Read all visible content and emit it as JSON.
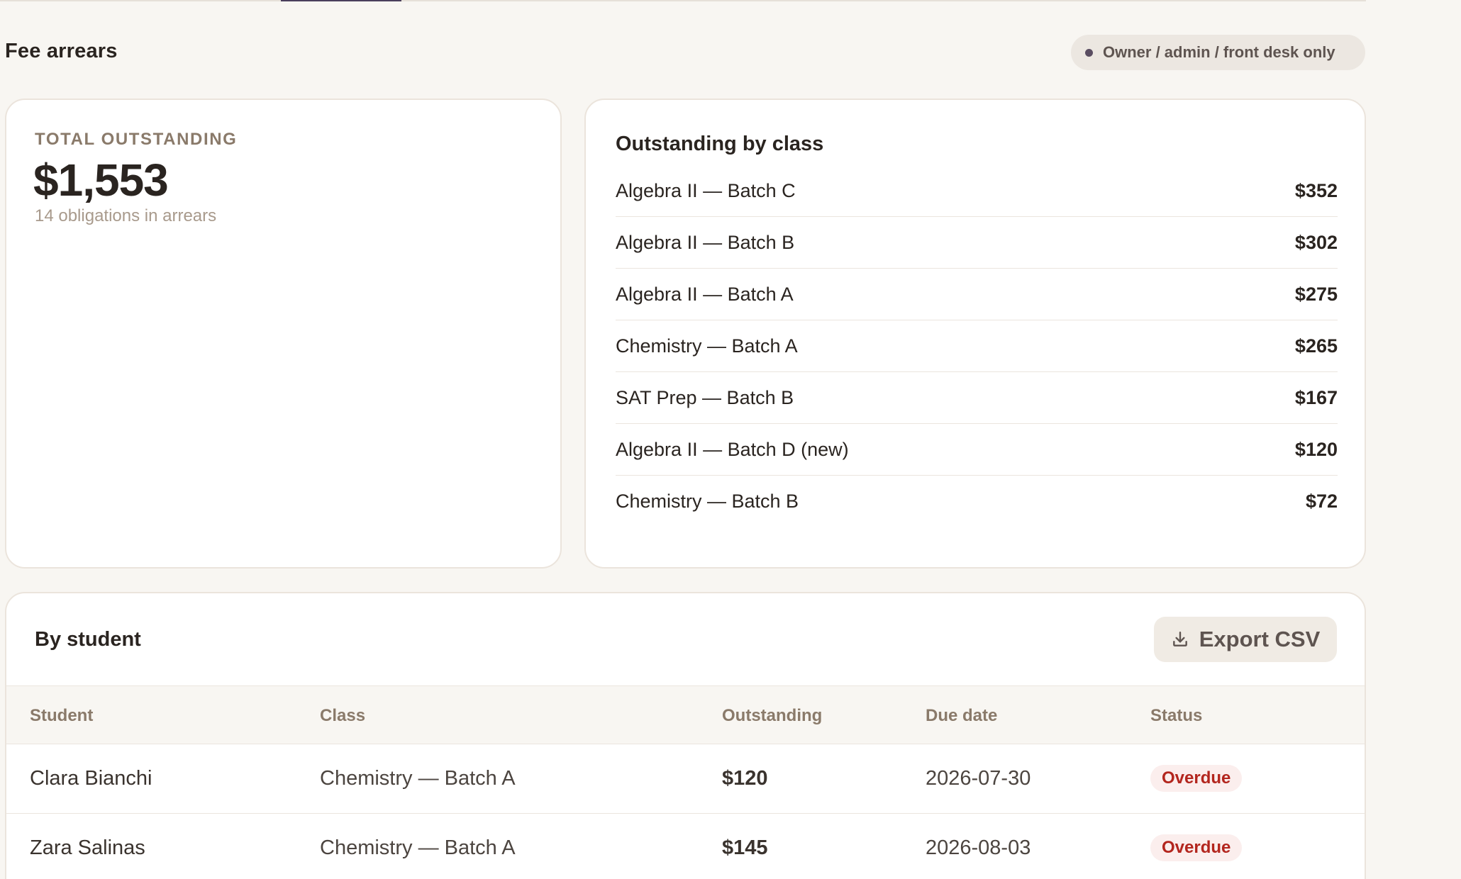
{
  "page": {
    "title": "Fee arrears",
    "access_note": "Owner / admin / front desk only"
  },
  "summary": {
    "label": "TOTAL OUTSTANDING",
    "total": "$1,553",
    "subtitle": "14 obligations in arrears"
  },
  "by_class": {
    "heading": "Outstanding by class",
    "rows": [
      {
        "name": "Algebra II — Batch C",
        "amount": "$352"
      },
      {
        "name": "Algebra II — Batch B",
        "amount": "$302"
      },
      {
        "name": "Algebra II — Batch A",
        "amount": "$275"
      },
      {
        "name": "Chemistry — Batch A",
        "amount": "$265"
      },
      {
        "name": "SAT Prep — Batch B",
        "amount": "$167"
      },
      {
        "name": "Algebra II — Batch D (new)",
        "amount": "$120"
      },
      {
        "name": "Chemistry — Batch B",
        "amount": "$72"
      }
    ]
  },
  "by_student": {
    "heading": "By student",
    "export_label": "Export CSV",
    "columns": [
      "Student",
      "Class",
      "Outstanding",
      "Due date",
      "Status"
    ],
    "rows": [
      {
        "student": "Clara Bianchi",
        "class": "Chemistry — Batch A",
        "outstanding": "$120",
        "due": "2026-07-30",
        "status": "Overdue"
      },
      {
        "student": "Zara Salinas",
        "class": "Chemistry — Batch A",
        "outstanding": "$145",
        "due": "2026-08-03",
        "status": "Overdue"
      }
    ]
  },
  "icons": {
    "export": "download-icon",
    "access": "dot-icon"
  },
  "colors": {
    "background": "#f8f6f2",
    "accent": "#4a3f5c",
    "overdue_text": "#b3261e",
    "overdue_bg": "#fbeeed"
  }
}
